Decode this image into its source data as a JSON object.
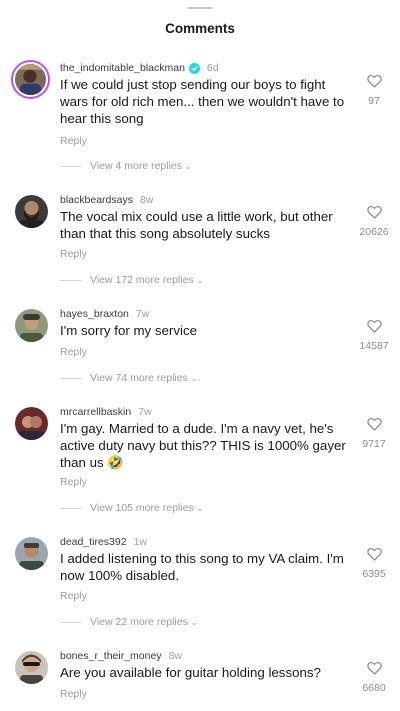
{
  "header": {
    "title": "Comments"
  },
  "comments": [
    {
      "username": "the_indomitable_blackman",
      "verified": true,
      "age": "6d",
      "text": "If we could just stop sending our boys to fight wars for old rich men... then we wouldn't have to hear this song",
      "reply_label": "Reply",
      "view_more": "View 4 more replies",
      "likes": "97"
    },
    {
      "username": "blackbeardsays",
      "verified": false,
      "age": "8w",
      "text": "The vocal mix could use a little work, but other than that this song absolutely sucks",
      "reply_label": "Reply",
      "view_more": "View 172 more replies",
      "likes": "20626"
    },
    {
      "username": "hayes_braxton",
      "verified": false,
      "age": "7w",
      "text": "I'm sorry for my service",
      "reply_label": "Reply",
      "view_more": "View 74 more replies",
      "likes": "14587"
    },
    {
      "username": "mrcarrellbaskin",
      "verified": false,
      "age": "7w",
      "text": "I'm gay. Married to a dude. I'm a navy vet, he's active duty navy but this?? THIS is 1000% gayer than us 🤣",
      "reply_label": "Reply",
      "view_more": "View 105 more replies",
      "likes": "9717"
    },
    {
      "username": "dead_tires392",
      "verified": false,
      "age": "1w",
      "text": "I added listening to this song to my VA claim. I'm now 100% disabled.",
      "reply_label": "Reply",
      "view_more": "View 22 more replies",
      "likes": "6395"
    },
    {
      "username": "bones_r_their_money",
      "verified": false,
      "age": "8w",
      "text": "Are you available for guitar holding lessons?",
      "reply_label": "Reply",
      "likes": "6680"
    }
  ],
  "icons": {
    "like": "heart-outline-icon",
    "verified": "verified-badge-icon",
    "expand": "chevron-down-icon"
  },
  "colors": {
    "verified": "#20d5ec",
    "avatar_ring": "#c34df5",
    "secondary_text": "#9b9ba3"
  }
}
